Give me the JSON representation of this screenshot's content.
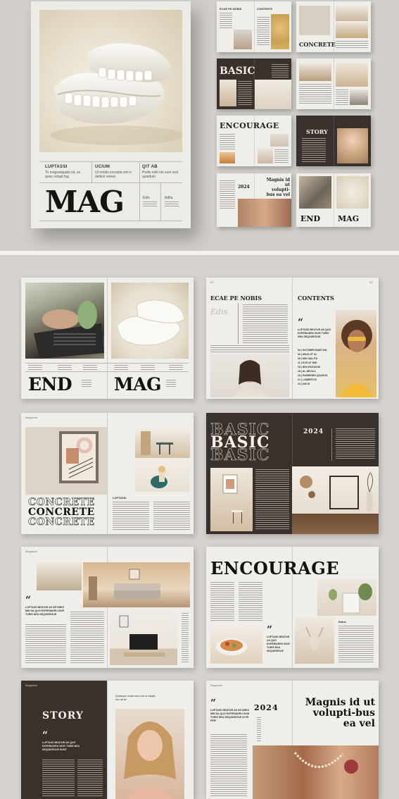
{
  "cover": {
    "col1_title": "LUPTASSI",
    "col1_text": "To magnatquatu sit, se quas volupt fug",
    "col2_title": "UCIUM",
    "col2_text": "Ut modis excepta sim e dellest velest",
    "col3_title": "QIT AB",
    "col3_text": "Pedis velit nis sum sed quiatium",
    "small1": "Edis",
    "small2": "Adita",
    "big_title": "MAG"
  },
  "thumbs": {
    "t1_left": "ECAE PE NOBIS",
    "t1_right": "CONTENTS",
    "t2_word": "CONCRETE",
    "t3_word": "BASIC",
    "t5_word": "ENCOURAGE",
    "t6_word": "STORY",
    "t7_year": "2024",
    "t7_heading": "Magnis id ut volupti-bus ea vel",
    "t8_left": "END",
    "t8_right": "MAG"
  },
  "spreads": {
    "s1": {
      "left": "END",
      "right": "MAG"
    },
    "s2": {
      "title": "ECAE PE NOBIS",
      "script": "Edis",
      "contents": "CONTENTS",
      "quote_text": "LUPTASS BEATUR AS QUO EXPERIAERU INVE TURIS NEA SEQUIDEGUE",
      "toc": [
        "04 | INCTIBER NIAETUM",
        "06 | MAIS UT UL",
        "09 | MIS VALI ES",
        "11 | EOS AT MIS",
        "15 | IEDI EXOUIUM",
        "18 | AL AECULI",
        "19 | RUBERIEN QUADUS",
        "21 | LAMERTUS",
        "24 | NIS IS"
      ]
    },
    "s3": {
      "word": "CONCRETE",
      "label": "LUPTASSI"
    },
    "s4": {
      "word": "BASIC",
      "year": "2024"
    },
    "s5": {
      "quote": "LUPTASS BEATUR AS INTURES MIN SA QUO EXPERIAERU INVE TURIS NEA SEQUIDEGUE"
    },
    "s6": {
      "word": "ENCOURAGE",
      "quote": "LUPTASS BEATUR AS QUO EXPERIAERU INVE TURIS NEA SEQUIDEGUE",
      "label": "Eatus"
    },
    "s7": {
      "word": "STORY",
      "quote": "LUPTASS BEATUR AS QUO EXPERIAERU INVE TURIS NEA SEQUIDEGUE SUNT",
      "caption": "Quatuque model seul sub ut volupti, hoc ab sit"
    },
    "s8": {
      "year": "2024",
      "heading": "Magnis id ut volupti-bus ea vel",
      "quote": "LUPTASS BEATUR AS INTURES MIN SA QUO EXPERIAERU INVE TURIS NEA SEQUIDEGUE SI PE PEIF"
    }
  }
}
